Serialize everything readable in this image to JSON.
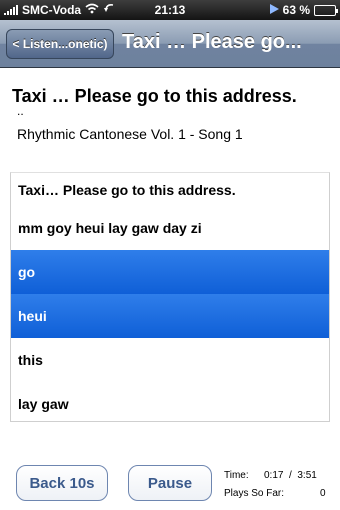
{
  "status_bar": {
    "carrier": "SMC-Voda",
    "time": "21:13",
    "battery": "63 %",
    "battery_level": 0.63
  },
  "nav": {
    "back_label": "< Listen...onetic)",
    "title": "Taxi … Please go..."
  },
  "header": {
    "title": "Taxi … Please go to this address.",
    "dots": "..",
    "subtitle": "Rhythmic Cantonese Vol. 1 - Song 1"
  },
  "lyrics": [
    {
      "text": "Taxi… Please go to this address.",
      "selected": false
    },
    {
      "text": "mm goy heui lay gaw day zi",
      "selected": false
    },
    {
      "text": "go",
      "selected": true
    },
    {
      "text": "heui",
      "selected": true
    },
    {
      "text": "this",
      "selected": false
    },
    {
      "text": "lay gaw",
      "selected": false
    }
  ],
  "controls": {
    "back_label": "Back 10s",
    "pause_label": "Pause",
    "time_label": "Time:",
    "time_value": "0:17  /  3:51",
    "plays_label": "Plays So Far:",
    "plays_value": "0"
  },
  "colors": {
    "selection": "#1a6ee0",
    "nav_bar": "#7f91ab",
    "button_text": "#3b5a8c",
    "battery_fill": "#57d024"
  }
}
